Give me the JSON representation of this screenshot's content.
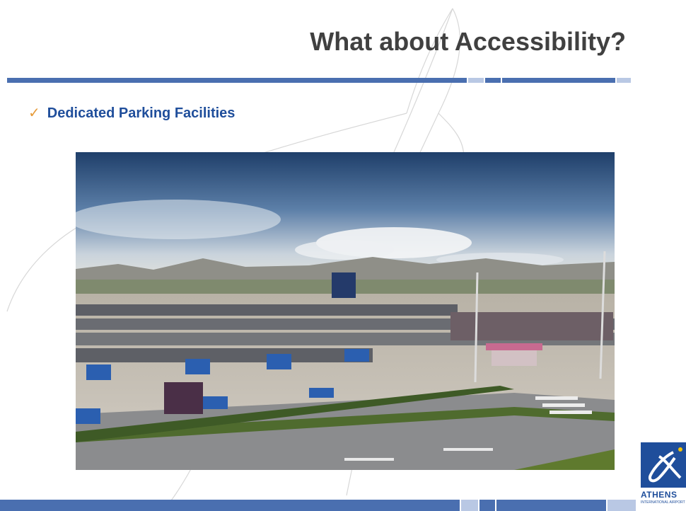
{
  "slide": {
    "title": "What about Accessibility?",
    "bullet": "Dedicated Parking Facilities",
    "bullet_icon": "checkmark-icon"
  },
  "photo": {
    "subject": "airport-parking-lot-with-accessible-spaces"
  },
  "logo": {
    "text": "ATHENS",
    "subtext": "INTERNATIONAL AIRPORT",
    "icon": "alpha-airport-logo-icon"
  },
  "colors": {
    "title": "#404040",
    "bullet_text": "#1f4e9b",
    "checkmark": "#e69b3a",
    "bar_dark": "#4a6fb0",
    "bar_light": "#b9c8e4"
  }
}
